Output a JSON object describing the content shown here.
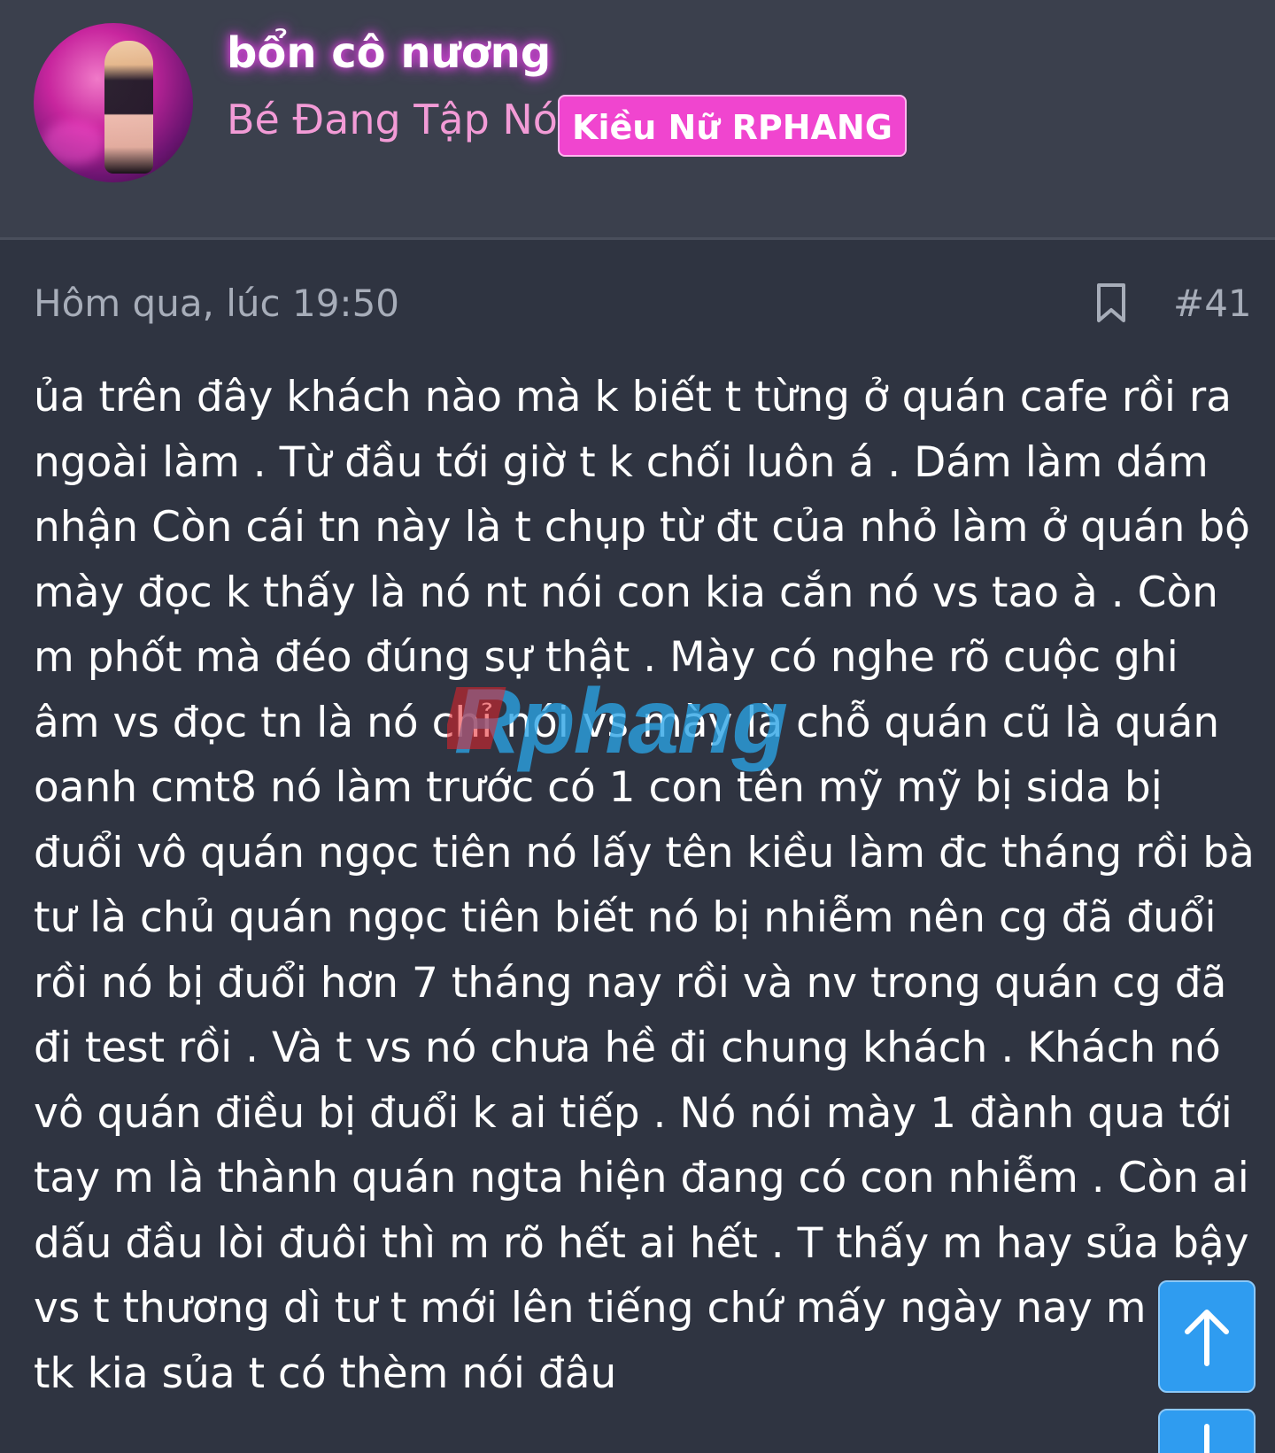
{
  "user": {
    "name": "bổn cô nương",
    "title": "Bé Đang Tập Nói",
    "banner": "Kiều Nữ RPHANG"
  },
  "post": {
    "date": "Hôm qua, lúc 19:50",
    "number": "#41",
    "content": "ủa trên đây khách nào mà k biết t từng ở quán cafe rồi ra\nngoài làm . Từ đầu tới giờ t k chối luôn á . Dám làm dám\nnhận Còn cái tn này là t chụp từ đt của nhỏ làm ở quán bộ\nmày đọc k thấy là nó nt nói con kia cắn nó vs tao à . Còn\nm phốt mà đéo đúng sự thật . Mày có nghe rõ cuộc ghi\nâm vs đọc tn là nó chỉ nói vs mày là chỗ quán cũ là quán\noanh cmt8 nó làm trước có 1 con tên mỹ mỹ bị sida bị\nđuổi vô quán ngọc tiên nó lấy tên kiều làm đc tháng rồi bà\ntư là chủ quán ngọc tiên biết nó bị nhiễm nên cg đã đuổi\nrồi nó bị đuổi hơn 7 tháng nay rồi và nv trong quán cg đã\nđi test rồi . Và t vs nó chưa hề đi chung khách . Khách nó\nvô quán điều bị đuổi k ai tiếp . Nó nói mày 1 đành qua tới\ntay m là thành quán ngta hiện đang có con nhiễm . Còn ai\ndấu đầu lòi đuôi thì m rõ hết ai hết . T thấy m hay sủa bậy\nvs t thương dì tư t mới lên tiếng chứ mấy ngày nay m vs\ntk kia sủa t có thèm nói đâu"
  },
  "watermark": {
    "text": "Rphang",
    "colors": [
      "#e8222a",
      "#2aa4e6"
    ]
  },
  "icons": {
    "bookmark": "bookmark-icon",
    "scroll_up": "arrow-up-icon",
    "scroll_down": "arrow-down-icon"
  }
}
